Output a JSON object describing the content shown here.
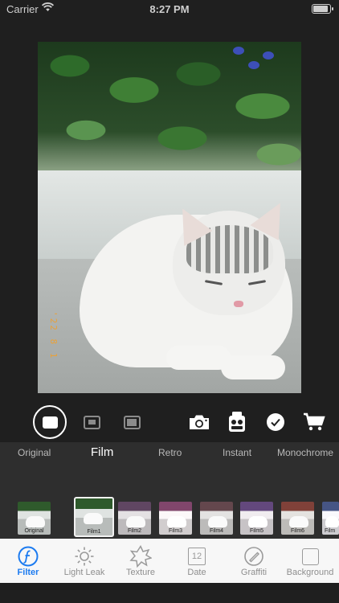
{
  "status": {
    "carrier": "Carrier",
    "time": "8:27 PM"
  },
  "photo": {
    "datestamp": "'22 8 1"
  },
  "categories": [
    "Original",
    "Film",
    "Retro",
    "Instant",
    "Monochrome"
  ],
  "active_category": "Film",
  "thumbs": [
    "Original",
    "Film1",
    "Film2",
    "Film3",
    "Film4",
    "Film5",
    "Film6",
    "Film"
  ],
  "selected_thumb": "Film1",
  "nav": {
    "filter": "Filter",
    "light_leak": "Light Leak",
    "texture": "Texture",
    "date": "Date",
    "date_icon": "12",
    "graffiti": "Graffiti",
    "background": "Background"
  },
  "colors": {
    "accent": "#1c7bf0",
    "datestamp": "#e8a13a",
    "panel": "#2e2e2e",
    "nav_bg": "#f7f7f7"
  },
  "icons": [
    "wifi-icon",
    "battery-icon",
    "camera-icon",
    "frames-icon",
    "check-icon",
    "cart-icon",
    "filter-icon",
    "light-leak-icon",
    "texture-icon",
    "date-icon",
    "graffiti-icon",
    "background-icon"
  ]
}
